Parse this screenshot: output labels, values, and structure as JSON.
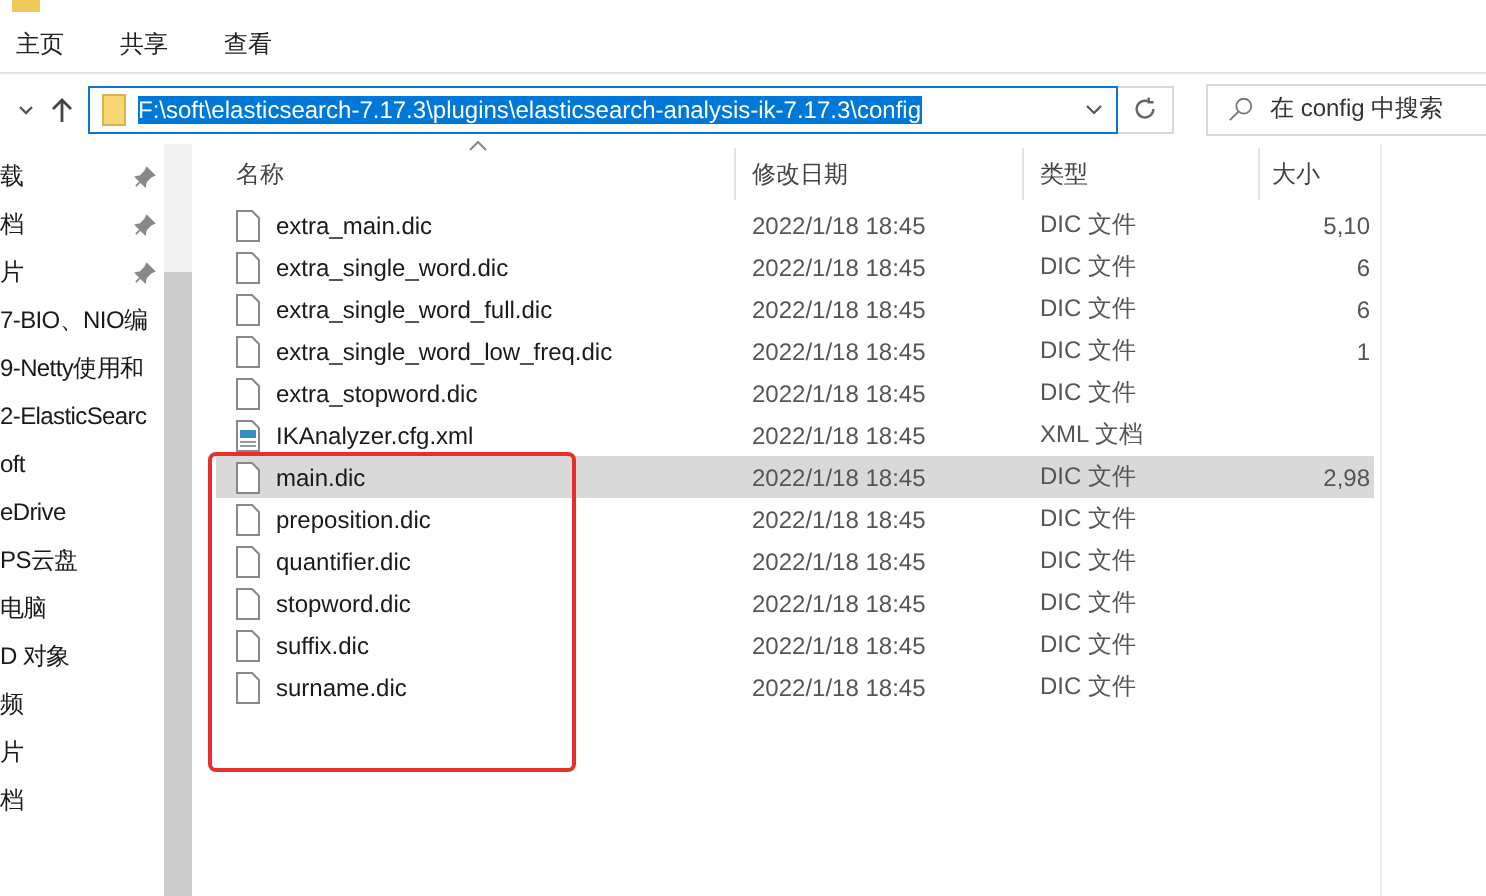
{
  "ribbon_tabs": [
    {
      "label": "主页",
      "selected": false
    },
    {
      "label": "共享",
      "selected": false
    },
    {
      "label": "查看",
      "selected": false
    }
  ],
  "address_bar": {
    "path": "F:\\soft\\elasticsearch-7.17.3\\plugins\\elasticsearch-analysis-ik-7.17.3\\config"
  },
  "search": {
    "placeholder": "在 config 中搜索"
  },
  "sidebar": {
    "items": [
      {
        "label": "载",
        "pinned": true
      },
      {
        "label": "档",
        "pinned": true
      },
      {
        "label": "片",
        "pinned": true
      },
      {
        "label": "7-BIO、NIO编",
        "pinned": false
      },
      {
        "label": "9-Netty使用和",
        "pinned": false
      },
      {
        "label": "2-ElasticSearc",
        "pinned": false
      },
      {
        "label": "oft",
        "pinned": false
      },
      {
        "label": "eDrive",
        "pinned": false
      },
      {
        "label": "PS云盘",
        "pinned": false
      },
      {
        "label": "电脑",
        "pinned": false
      },
      {
        "label": "D 对象",
        "pinned": false
      },
      {
        "label": "频",
        "pinned": false
      },
      {
        "label": "片",
        "pinned": false
      },
      {
        "label": "档",
        "pinned": false
      }
    ]
  },
  "table": {
    "columns": [
      "名称",
      "修改日期",
      "类型",
      "大小"
    ],
    "rows": [
      {
        "kind": "file",
        "name": "extra_main.dic",
        "date": "2022/1/18 18:45",
        "type": "DIC 文件",
        "size": "5,10",
        "selected": false
      },
      {
        "kind": "file",
        "name": "extra_single_word.dic",
        "date": "2022/1/18 18:45",
        "type": "DIC 文件",
        "size": "6",
        "selected": false
      },
      {
        "kind": "file",
        "name": "extra_single_word_full.dic",
        "date": "2022/1/18 18:45",
        "type": "DIC 文件",
        "size": "6",
        "selected": false
      },
      {
        "kind": "file",
        "name": "extra_single_word_low_freq.dic",
        "date": "2022/1/18 18:45",
        "type": "DIC 文件",
        "size": "1",
        "selected": false
      },
      {
        "kind": "file",
        "name": "extra_stopword.dic",
        "date": "2022/1/18 18:45",
        "type": "DIC 文件",
        "selected": false
      },
      {
        "kind": "xml",
        "name": "IKAnalyzer.cfg.xml",
        "date": "2022/1/18 18:45",
        "type": "XML 文档",
        "selected": false
      },
      {
        "kind": "file",
        "name": "main.dic",
        "date": "2022/1/18 18:45",
        "type": "DIC 文件",
        "size": "2,98",
        "selected": true
      },
      {
        "kind": "file",
        "name": "preposition.dic",
        "date": "2022/1/18 18:45",
        "type": "DIC 文件",
        "selected": false
      },
      {
        "kind": "file",
        "name": "quantifier.dic",
        "date": "2022/1/18 18:45",
        "type": "DIC 文件",
        "selected": false
      },
      {
        "kind": "file",
        "name": "stopword.dic",
        "date": "2022/1/18 18:45",
        "type": "DIC 文件",
        "selected": false
      },
      {
        "kind": "file",
        "name": "suffix.dic",
        "date": "2022/1/18 18:45",
        "type": "DIC 文件",
        "selected": false
      },
      {
        "kind": "file",
        "name": "surname.dic",
        "date": "2022/1/18 18:45",
        "type": "DIC 文件",
        "selected": false
      }
    ]
  }
}
